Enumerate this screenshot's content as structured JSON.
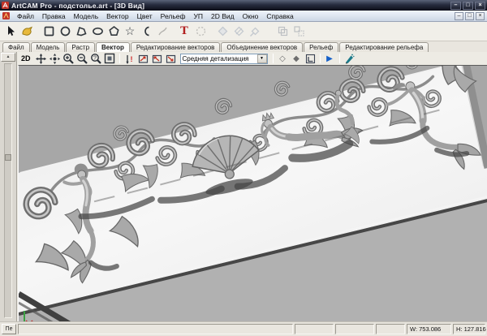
{
  "titlebar": {
    "title": "ArtCAM Pro - подстолье.art - [3D Вид]",
    "minimize": "–",
    "maximize": "□",
    "close": "×"
  },
  "menubar": {
    "items": [
      "Файл",
      "Правка",
      "Модель",
      "Вектор",
      "Цвет",
      "Рельеф",
      "УП",
      "2D Вид",
      "Окно",
      "Справка"
    ],
    "mdi": {
      "minimize": "–",
      "restore": "□",
      "close": "×"
    }
  },
  "tabs": {
    "items": [
      "Файл",
      "Модель",
      "Растр",
      "Вектор",
      "Редактирование векторов",
      "Объединение векторов",
      "Рельеф",
      "Редактирование рельефа"
    ],
    "active": "Вектор"
  },
  "toolbar_view": {
    "label_2d": "2D",
    "detail_dropdown": {
      "value": "Средняя детализация",
      "arrow": "▼"
    },
    "wireframe_glyph": "◇",
    "shaded_glyph": "◆",
    "play_glyph": "▶"
  },
  "toolbar_main": {
    "star_glyph": "☆",
    "text_tool_glyph": "T"
  },
  "left_panel": {
    "scroll_up": "▲",
    "collapsed_tab": "Пе"
  },
  "statusbar": {
    "width_readout": "W: 753.086",
    "height_readout": "H: 127.816"
  },
  "colors": {
    "titlebar_dark": "#0c0e18",
    "menu_light": "#eff4fb",
    "toolbar_bg": "#f1efe9",
    "view_background": "#a7a7a7",
    "panel_face": "#f4f4f4",
    "groove": "#474747",
    "below_groove": "#b1b1b1",
    "text_tool_red": "#b22222",
    "play_blue": "#1560c8",
    "origin_green": "#3aa043",
    "origin_red": "#c03030",
    "transform_yellow": "#e8b93c"
  },
  "icons": {
    "toolbar_main": [
      "select-arrow",
      "transform-tool",
      "rectangle-tool",
      "circle-tool",
      "polyline-tool",
      "ellipse-tool",
      "polygon-tool",
      "star-tool",
      "arc-tool",
      "freehand-tool",
      "text-tool",
      "dashed-circle-tool",
      "node-edit-tool",
      "node-cut-tool",
      "node-move-tool",
      "group-tool",
      "ungroup-tool"
    ],
    "toolbar_view": [
      "pan",
      "center-view",
      "zoom-in",
      "zoom-out",
      "zoom-selection",
      "zoom-fit",
      "scale-z",
      "view-preset-front",
      "view-preset-side",
      "view-preset-iso",
      "wireframe",
      "shaded",
      "draft",
      "simulate",
      "spray-tool"
    ]
  }
}
